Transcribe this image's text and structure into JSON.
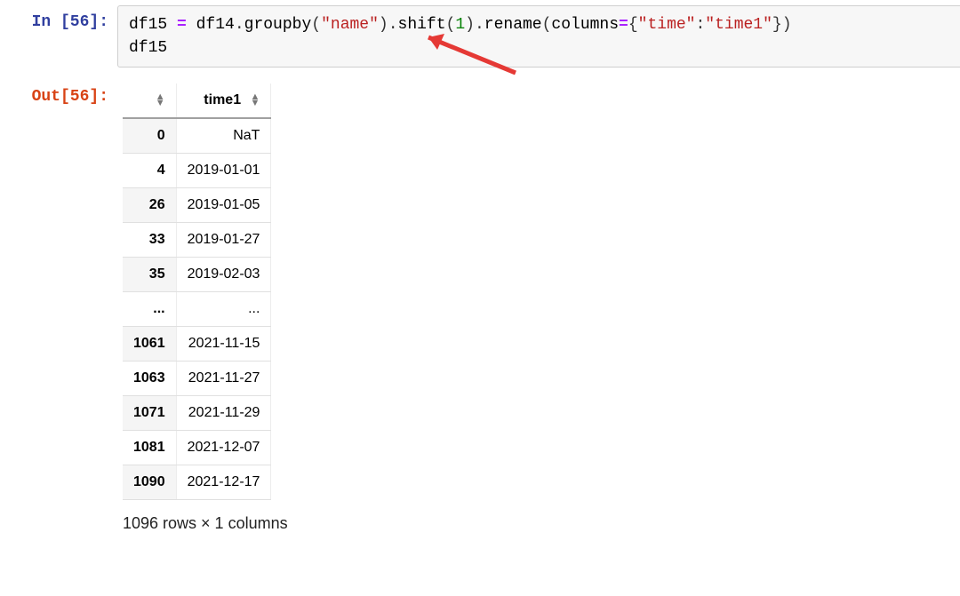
{
  "in_prompt": "In [56]:",
  "out_prompt": "Out[56]:",
  "code": {
    "line1": {
      "v1": "df15",
      "eq": " = ",
      "v2": "df14",
      "dot1": ".",
      "f1": "groupby",
      "p1": "(",
      "s1": "\"name\"",
      "p2": ")",
      "dot2": ".",
      "f2": "shift",
      "p3": "(",
      "n1": "1",
      "p4": ")",
      "dot3": ".",
      "f3": "rename",
      "p5": "(",
      "kw1": "columns",
      "eq2": "=",
      "p6": "{",
      "s2": "\"time\"",
      "colon": ":",
      "s3": "\"time1\"",
      "p7": "}",
      "p8": ")"
    },
    "line2": "df15"
  },
  "table": {
    "col_header": "time1",
    "rows": [
      {
        "idx": "0",
        "val": "NaT"
      },
      {
        "idx": "4",
        "val": "2019-01-01"
      },
      {
        "idx": "26",
        "val": "2019-01-05"
      },
      {
        "idx": "33",
        "val": "2019-01-27"
      },
      {
        "idx": "35",
        "val": "2019-02-03"
      },
      {
        "idx": "...",
        "val": "..."
      },
      {
        "idx": "1061",
        "val": "2021-11-15"
      },
      {
        "idx": "1063",
        "val": "2021-11-27"
      },
      {
        "idx": "1071",
        "val": "2021-11-29"
      },
      {
        "idx": "1081",
        "val": "2021-12-07"
      },
      {
        "idx": "1090",
        "val": "2021-12-17"
      }
    ]
  },
  "summary": "1096 rows × 1 columns",
  "glyph": {
    "sort_up": "▲",
    "sort_down": "▼"
  }
}
